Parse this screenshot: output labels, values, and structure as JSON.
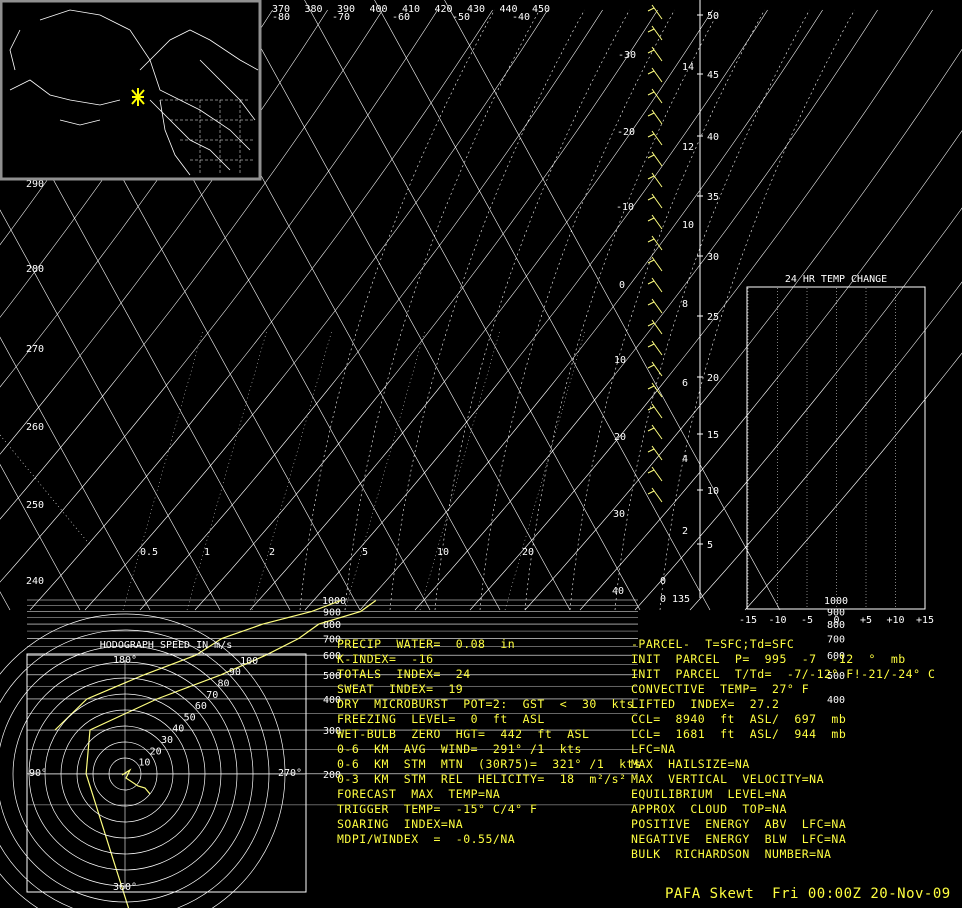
{
  "chart_data": [
    {
      "type": "skew-t",
      "x_top_ticks_k": [
        "370",
        "380",
        "390",
        "400",
        "410",
        "420",
        "430",
        "440",
        "450"
      ],
      "x_top_ticks_c": [
        "-80",
        "-70",
        "-60",
        "-50",
        "-40"
      ],
      "isotherm_labels_right": [
        "-30",
        "-20",
        "-10",
        "0",
        "10",
        "20",
        "30",
        "40"
      ],
      "isobars_mb": [
        200,
        300,
        400,
        500,
        600,
        700,
        800,
        900,
        1000
      ],
      "theta_labels_left": [
        "290",
        "280",
        "270",
        "260",
        "250",
        "240"
      ],
      "mixing_ratio_labels": [
        "0.5",
        "1",
        "2",
        "5",
        "10",
        "20"
      ],
      "height_kft": [
        "50",
        "45",
        "40",
        "35",
        "30",
        "25",
        "20",
        "15",
        "10",
        "5"
      ],
      "height_km": [
        "14",
        "12",
        "10",
        "8",
        "6",
        "4",
        "2"
      ],
      "bottom_left_labels": [
        "0",
        "0"
      ],
      "bottom_right_label": "135",
      "temperature_profile": {
        "name": "",
        "points": [
          [
            50,
            -67
          ],
          [
            200,
            -62
          ],
          [
            300,
            -58
          ],
          [
            400,
            -46
          ],
          [
            500,
            -35
          ],
          [
            600,
            -27
          ],
          [
            700,
            -21
          ],
          [
            800,
            -17
          ],
          [
            900,
            -10
          ],
          [
            995,
            -7
          ]
        ]
      },
      "dewpoint_profile": {
        "name": "",
        "points": [
          [
            300,
            -63
          ],
          [
            400,
            -56
          ],
          [
            500,
            -46
          ],
          [
            600,
            -37
          ],
          [
            700,
            -32
          ],
          [
            800,
            -25
          ],
          [
            900,
            -17
          ],
          [
            995,
            -12
          ]
        ]
      }
    },
    {
      "type": "line",
      "title": "24 HR TEMP CHANGE",
      "x_ticks": [
        "-15",
        "-10",
        "-5",
        "0",
        "+5",
        "+10",
        "+15"
      ],
      "y_ticks_mb": [
        400,
        500,
        600,
        700,
        800,
        900,
        1000
      ]
    },
    {
      "type": "polar",
      "title": "HODOGRAPH SPEED IN m/s",
      "ring_labels": [
        "10",
        "20",
        "30",
        "40",
        "50",
        "60",
        "70",
        "80",
        "90",
        "100"
      ],
      "direction_labels": {
        "top": "180°",
        "left": "90°",
        "right": "270°",
        "bottom": "360°"
      }
    }
  ],
  "indices_left": [
    "PRECIP  WATER=  0.08  in",
    "K-INDEX=  -16",
    "TOTALS  INDEX=  24",
    "SWEAT  INDEX=  19",
    "DRY  MICROBURST  POT=2:  GST  <  30  kts",
    "FREEZING  LEVEL=  0  ft  ASL",
    "WET-BULB  ZERO  HGT=  442  ft  ASL",
    "0-6  KM  AVG  WIND=  291° /1  kts",
    "0-6  KM  STM  MTN  (30R75)=  321° /1  kts",
    "0-3  KM  STM  REL  HELICITY=  18  m²/s²",
    "FORECAST  MAX  TEMP=NA",
    "TRIGGER  TEMP=  -15° C/4° F",
    "SOARING  INDEX=NA",
    "MDPI/WINDEX  =  -0.55/NA"
  ],
  "indices_right": [
    "-PARCEL-  T=SFC;Td=SFC",
    "INIT  PARCEL  P=  995  -7  -12  °  mb",
    "INIT  PARCEL  T/Td=  -7/-12° F!-21/-24° C",
    "CONVECTIVE  TEMP=  27° F",
    "LIFTED  INDEX=  27.2",
    "CCL=  8940  ft  ASL/  697  mb",
    "LCL=  1681  ft  ASL/  944  mb",
    "LFC=NA",
    "MAX  HAILSIZE=NA",
    "MAX  VERTICAL  VELOCITY=NA",
    "EQUILIBRIUM  LEVEL=NA",
    "APPROX  CLOUD  TOP=NA",
    "POSITIVE  ENERGY  ABV  LFC=NA",
    "NEGATIVE  ENERGY  BLW  LFC=NA",
    "BULK  RICHARDSON  NUMBER=NA"
  ],
  "footer": "PAFA Skewt  Fri 00:00Z 20-Nov-09",
  "colors": {
    "background": "#000000",
    "grid": "#ffffff",
    "profile": "#ffff80",
    "text": "#ffff40",
    "map_frame": "#909090",
    "station_marker": "#ffff00"
  },
  "inset_map": {
    "marker_icon": "station-marker-icon"
  }
}
